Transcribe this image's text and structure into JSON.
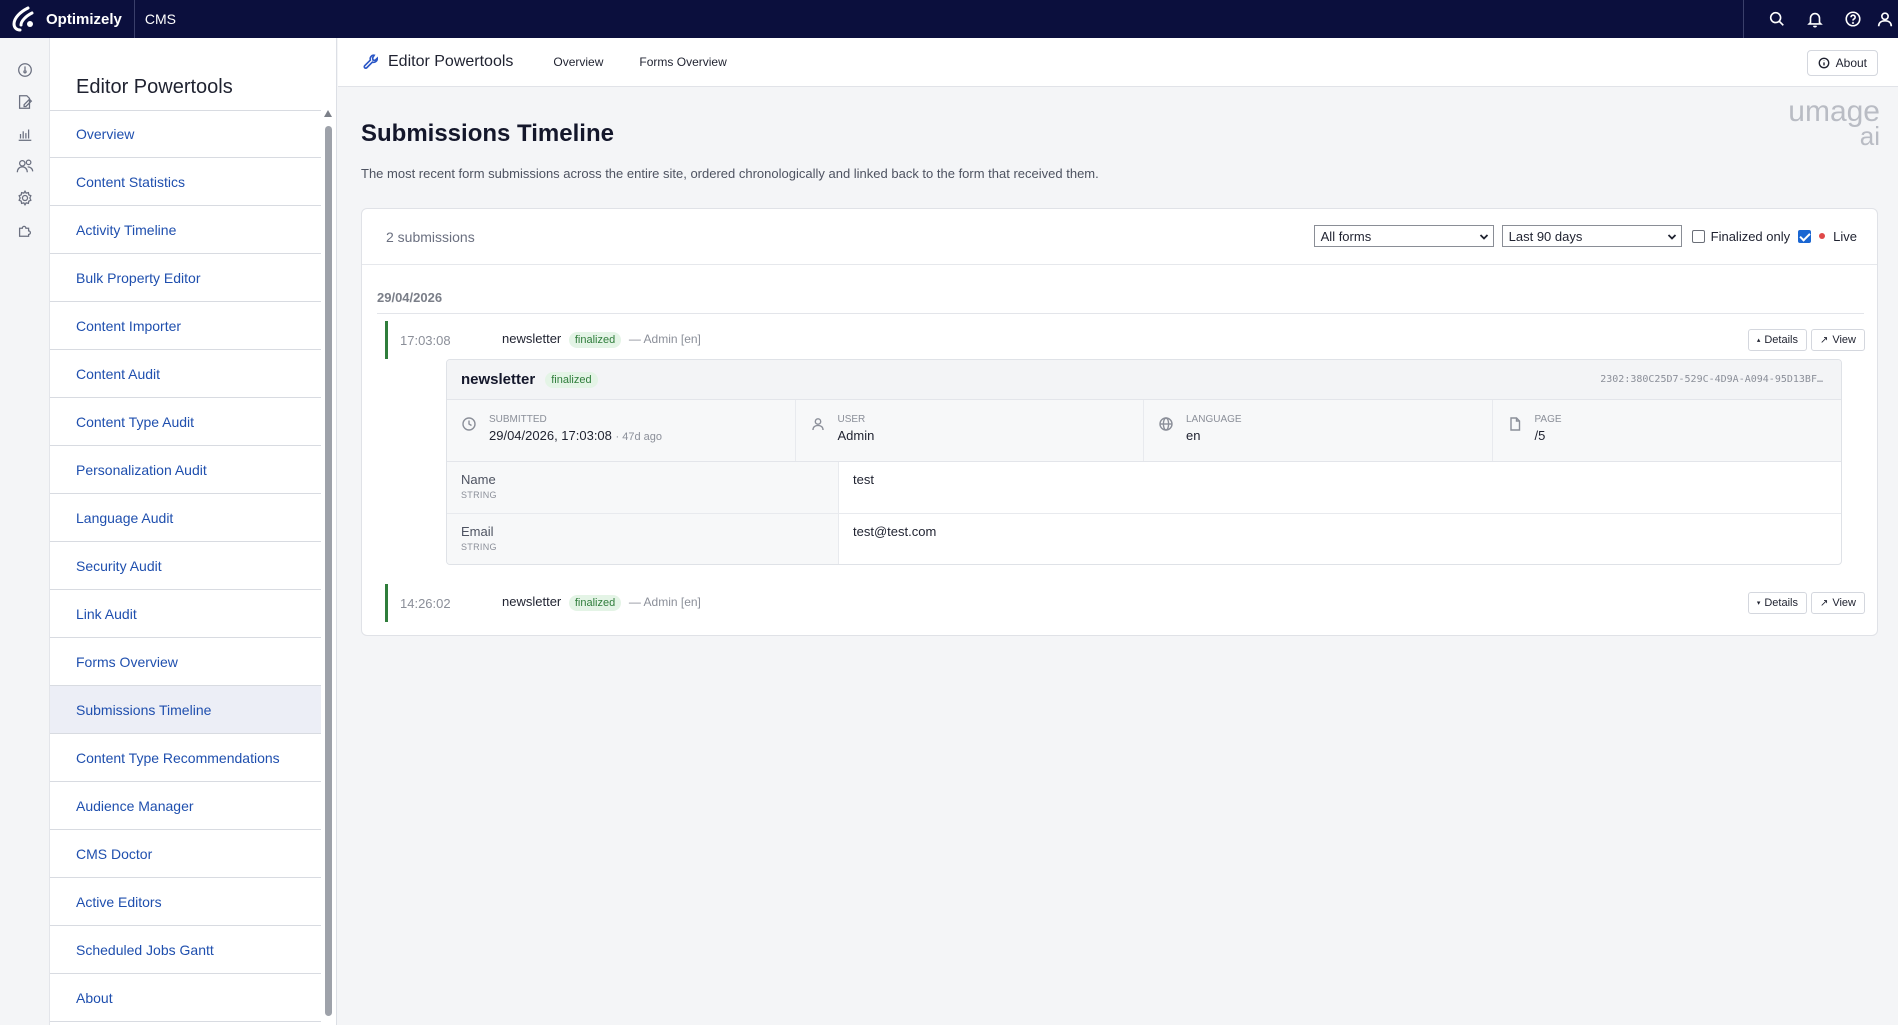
{
  "topbar": {
    "brand": "Optimizely",
    "product": "CMS",
    "icons": [
      "search-icon",
      "bell-icon",
      "help-icon",
      "user-icon"
    ]
  },
  "rail": {
    "icons": [
      "dashboard-icon",
      "edit-icon",
      "reports-icon",
      "visitors-icon",
      "settings-icon",
      "addons-icon"
    ]
  },
  "sidebar": {
    "title": "Editor Powertools",
    "items": [
      {
        "label": "Overview"
      },
      {
        "label": "Content Statistics"
      },
      {
        "label": "Activity Timeline"
      },
      {
        "label": "Bulk Property Editor"
      },
      {
        "label": "Content Importer"
      },
      {
        "label": "Content Audit"
      },
      {
        "label": "Content Type Audit"
      },
      {
        "label": "Personalization Audit"
      },
      {
        "label": "Language Audit"
      },
      {
        "label": "Security Audit"
      },
      {
        "label": "Link Audit"
      },
      {
        "label": "Forms Overview"
      },
      {
        "label": "Submissions Timeline",
        "active": true
      },
      {
        "label": "Content Type Recommendations"
      },
      {
        "label": "Audience Manager"
      },
      {
        "label": "CMS Doctor"
      },
      {
        "label": "Active Editors"
      },
      {
        "label": "Scheduled Jobs Gantt"
      },
      {
        "label": "About"
      }
    ]
  },
  "header": {
    "title": "Editor Powertools",
    "tabs": [
      {
        "label": "Overview"
      },
      {
        "label": "Forms Overview"
      }
    ],
    "about_label": "About"
  },
  "main": {
    "title": "Submissions Timeline",
    "description": "The most recent form submissions across the entire site, ordered chronologically and linked back to the form that received them.",
    "watermark": {
      "line1": "umage",
      "line2": "ai"
    }
  },
  "card": {
    "count": "2 submissions",
    "filters": {
      "form_select": "All forms",
      "range_select": "Last 90 days",
      "finalized_label": "Finalized only",
      "finalized_checked": false,
      "live_label": "Live",
      "live_checked": true
    },
    "date_group": "29/04/2026",
    "entries": [
      {
        "time": "17:03:08",
        "form": "newsletter",
        "status": "finalized",
        "meta": "— Admin [en]",
        "details_label": "Details",
        "details_marker": "▴",
        "view_label": "View",
        "view_marker": "↗"
      },
      {
        "time": "14:26:02",
        "form": "newsletter",
        "status": "finalized",
        "meta": "— Admin [en]",
        "details_label": "Details",
        "details_marker": "▾",
        "view_label": "View",
        "view_marker": "↗"
      }
    ],
    "detail": {
      "form": "newsletter",
      "status": "finalized",
      "id": "2302:380C25D7-529C-4D9A-A094-95D13BF…",
      "meta": [
        {
          "label": "Submitted",
          "value": "29/04/2026, 17:03:08",
          "extra": "· 47d ago",
          "icon": "clock-icon"
        },
        {
          "label": "User",
          "value": "Admin",
          "extra": "",
          "icon": "user-icon"
        },
        {
          "label": "Language",
          "value": "en",
          "extra": "",
          "icon": "globe-icon"
        },
        {
          "label": "Page",
          "value": "/5",
          "extra": "",
          "icon": "page-icon"
        }
      ],
      "fields": [
        {
          "name": "Name",
          "type": "STRING",
          "value": "test"
        },
        {
          "name": "Email",
          "type": "STRING",
          "value": "test@test.com"
        }
      ]
    }
  },
  "colors": {
    "topbar": "#0b0f3d",
    "link": "#1f4fae",
    "accent_green": "#2f7d3b",
    "badge_bg": "#e4f4e6",
    "live_dot": "#e04848",
    "checkbox_on": "#1a66d2"
  }
}
